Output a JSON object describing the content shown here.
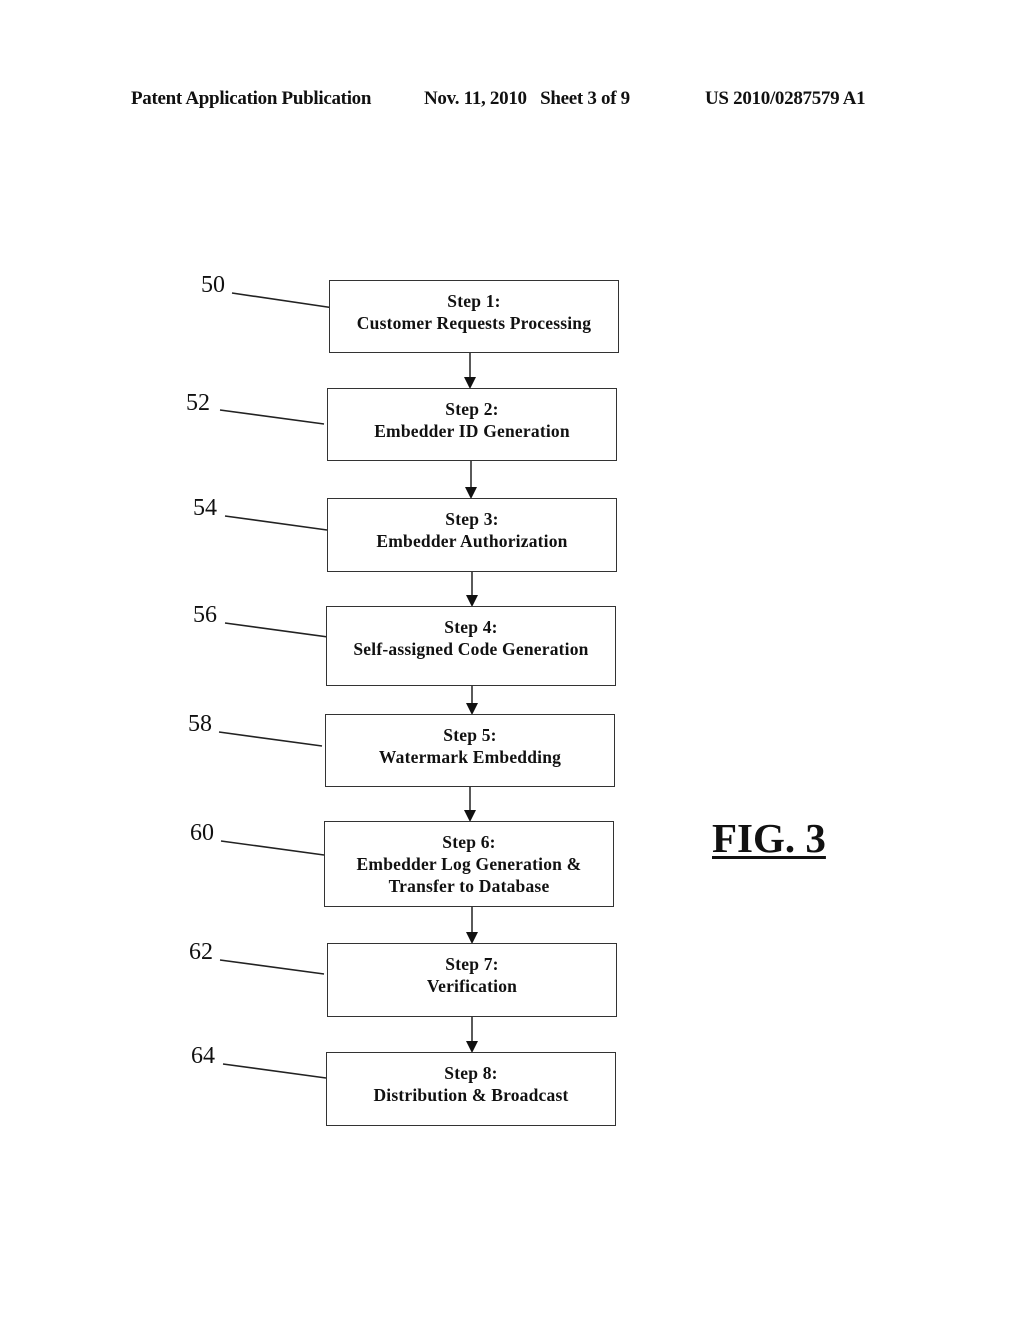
{
  "header": {
    "left": "Patent Application Publication",
    "middle": "Nov. 11, 2010   Sheet 3 of 9",
    "right": "US 2010/0287579 A1"
  },
  "figure_label": "FIG. 3",
  "steps": [
    {
      "ref": "50",
      "title": "Step 1:",
      "text": "Customer Requests Processing"
    },
    {
      "ref": "52",
      "title": "Step 2:",
      "text": "Embedder ID Generation"
    },
    {
      "ref": "54",
      "title": "Step 3:",
      "text": "Embedder Authorization"
    },
    {
      "ref": "56",
      "title": "Step 4:",
      "text": "Self-assigned Code Generation"
    },
    {
      "ref": "58",
      "title": "Step 5:",
      "text": "Watermark Embedding"
    },
    {
      "ref": "60",
      "title": "Step 6:",
      "text": "Embedder Log Generation &",
      "text2": "Transfer to Database"
    },
    {
      "ref": "62",
      "title": "Step 7:",
      "text": "Verification"
    },
    {
      "ref": "64",
      "title": "Step 8:",
      "text": "Distribution & Broadcast"
    }
  ]
}
